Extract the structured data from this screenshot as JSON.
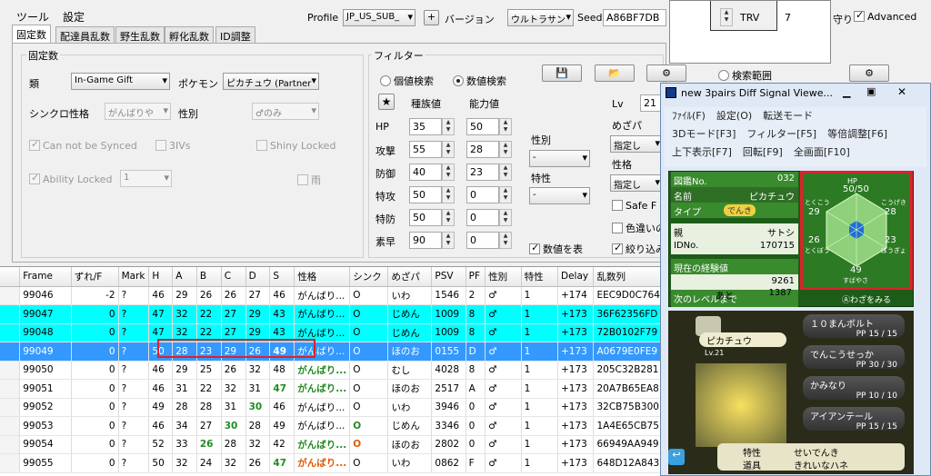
{
  "menu": {
    "tools": "ツール",
    "settings": "設定"
  },
  "toolbar": {
    "profile_label": "Profile",
    "profile_value": "JP_US_SUB_",
    "plus": "+",
    "version_label": "バージョン",
    "version_value": "ウルトラサン",
    "seed_label": "Seed",
    "seed_value": "A86BF7DB",
    "mamori": "守り",
    "advanced": "Advanced"
  },
  "tabs": [
    "固定数",
    "配達員乱数",
    "野生乱数",
    "孵化乱数",
    "ID調整"
  ],
  "fixed": {
    "group_title": "固定数",
    "kind_label": "類",
    "kind_value": "In-Game Gift",
    "pokemon_label": "ポケモン",
    "pokemon_value": "ピカチュウ (Partner",
    "sync_label": "シンクロ性格",
    "sync_value": "がんばりや",
    "gender_label": "性別",
    "gender_value": "♂のみ",
    "cannot_sync": "Can not be Synced",
    "three_ivs": "3IVs",
    "shiny_locked": "Shiny Locked",
    "ability_locked": "Ability Locked",
    "ability_value": "1",
    "rain": "雨"
  },
  "filter": {
    "group_title": "フィルター",
    "radio_iv": "個値検索",
    "radio_stat": "数値検索",
    "star": "★",
    "col_species": "種族値",
    "col_stat": "能力値",
    "stats": [
      {
        "label": "HP",
        "base": "35",
        "value": "50"
      },
      {
        "label": "攻撃",
        "base": "55",
        "value": "28"
      },
      {
        "label": "防御",
        "base": "40",
        "value": "23"
      },
      {
        "label": "特攻",
        "base": "50",
        "value": "0"
      },
      {
        "label": "特防",
        "base": "50",
        "value": "0"
      },
      {
        "label": "素早",
        "base": "90",
        "value": "0"
      }
    ],
    "seibetsu": "性別",
    "seibetsu_value": "-",
    "tokusei": "特性",
    "tokusei_value": "-",
    "lv_label": "Lv",
    "lv_value": "21",
    "mezapa": "めざパ",
    "shitei1": "指定し",
    "seikaku": "性格",
    "shitei2": "指定し",
    "safe": "Safe F",
    "irochigai": "色違いの",
    "shiborikomi": "絞り込み",
    "stat_search": "数値を表",
    "search_range": "検索範囲"
  },
  "grid": {
    "headers": [
      "Frame",
      "ずれ/F",
      "Mark",
      "H",
      "A",
      "B",
      "C",
      "D",
      "S",
      "性格",
      "シンク",
      "めざパ",
      "PSV",
      "PF",
      "性別",
      "特性",
      "Delay",
      "乱数列"
    ],
    "rows": [
      {
        "cls": "",
        "cells": [
          "99046",
          "-2",
          "?",
          "46",
          "29",
          "26",
          "26",
          "27",
          "46",
          "がんばり...",
          "O",
          "いわ",
          "1546",
          "2",
          "♂",
          "1",
          "+174",
          "EEC9D0C764"
        ]
      },
      {
        "cls": "cyan",
        "cells": [
          "99047",
          "0",
          "?",
          "47",
          "32",
          "22",
          "27",
          "29",
          "43",
          "がんばり...",
          "O",
          "じめん",
          "1009",
          "8",
          "♂",
          "1",
          "+173",
          "36F62356FD"
        ]
      },
      {
        "cls": "cyan",
        "cells": [
          "99048",
          "0",
          "?",
          "47",
          "32",
          "22",
          "27",
          "29",
          "43",
          "がんばり...",
          "O",
          "じめん",
          "1009",
          "8",
          "♂",
          "1",
          "+173",
          "72B0102F79"
        ]
      },
      {
        "cls": "blue",
        "cells": [
          "99049",
          "0",
          "?",
          "50",
          "28",
          "23",
          "29",
          "26",
          "49",
          "がんばり...",
          "O",
          "ほのお",
          "0155",
          "D",
          "♂",
          "1",
          "+173",
          "A0679E0FE9"
        ]
      },
      {
        "cls": "",
        "cells": [
          "99050",
          "0",
          "?",
          "46",
          "29",
          "25",
          "26",
          "32",
          "48",
          "がんばり...",
          "O",
          "むし",
          "4028",
          "8",
          "♂",
          "1",
          "+173",
          "205C32B281"
        ]
      },
      {
        "cls": "",
        "cells": [
          "99051",
          "0",
          "?",
          "46",
          "31",
          "22",
          "32",
          "31",
          "47",
          "がんばり...",
          "O",
          "ほのお",
          "2517",
          "A",
          "♂",
          "1",
          "+173",
          "20A7B65EA8"
        ]
      },
      {
        "cls": "",
        "cells": [
          "99052",
          "0",
          "?",
          "49",
          "28",
          "28",
          "31",
          "30",
          "46",
          "がんばり...",
          "O",
          "いわ",
          "3946",
          "0",
          "♂",
          "1",
          "+173",
          "32CB75B300"
        ]
      },
      {
        "cls": "",
        "cells": [
          "99053",
          "0",
          "?",
          "46",
          "34",
          "27",
          "30",
          "28",
          "49",
          "がんばり...",
          "O",
          "じめん",
          "3346",
          "0",
          "♂",
          "1",
          "+173",
          "1A4E65CB75"
        ]
      },
      {
        "cls": "",
        "cells": [
          "99054",
          "0",
          "?",
          "52",
          "33",
          "26",
          "28",
          "32",
          "42",
          "がんばり...",
          "O",
          "ほのお",
          "2802",
          "0",
          "♂",
          "1",
          "+173",
          "66949AA949"
        ]
      },
      {
        "cls": "",
        "cells": [
          "99055",
          "0",
          "?",
          "50",
          "32",
          "24",
          "32",
          "26",
          "47",
          "がんばり...",
          "O",
          "いわ",
          "0862",
          "F",
          "♂",
          "1",
          "+173",
          "648D12A843"
        ]
      }
    ]
  },
  "small_window": {
    "label": "TRV",
    "value": "7"
  },
  "game": {
    "title": "new 3pairs Diff Signal Viewe...",
    "menu1": [
      "ﾌｧｲﾙ(F)",
      "設定(O)",
      "転送モード"
    ],
    "menu2": [
      "3Dモード[F3]",
      "フィルター[F5]",
      "等倍調整[F6]"
    ],
    "menu3": [
      "上下表示[F7]",
      "回転[F9]",
      "全画面[F10]"
    ],
    "dex_label": "図鑑No.",
    "dex_value": "032",
    "name_label": "名前",
    "name_value": "ピカチュウ",
    "type_label": "タイプ",
    "type_value": "でんき",
    "ot_label": "親",
    "ot_value": "サトシ",
    "id_label": "IDNo.",
    "id_value": "170715",
    "exp_label": "現在の経験値",
    "exp_value": "9261",
    "next_label": "次のレベルまで",
    "ato": "あと",
    "next_value": "1387",
    "hex": {
      "hp_label": "HP",
      "hp": "50/50",
      "atk_label": "こうげき",
      "atk": "28",
      "def_label": "ぼうぎょ",
      "def": "23",
      "spd_label": "すばやさ",
      "spd": "49",
      "spdef_label": "とくぼう",
      "spdef": "26",
      "spatk_label": "とくこう",
      "spatk": "29"
    },
    "waza_hint": "Ⓐわざをみる",
    "poke_name": "ピカチュウ",
    "level": "Lv.21",
    "moves": [
      {
        "name": "１０まんボルト",
        "pp": "PP 15 / 15"
      },
      {
        "name": "でんこうせっか",
        "pp": "PP 30 / 30"
      },
      {
        "name": "かみなり",
        "pp": "PP 10 / 10"
      },
      {
        "name": "アイアンテール",
        "pp": "PP 15 / 15"
      }
    ],
    "ability_label": "特性",
    "ability_value": "せいでんき",
    "item_label": "道具",
    "item_value": "きれいなハネ"
  }
}
